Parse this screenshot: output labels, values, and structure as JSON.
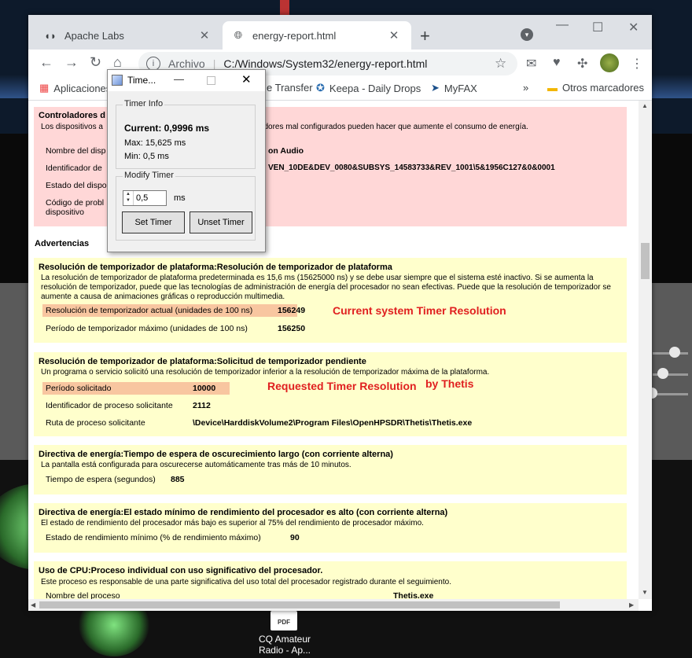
{
  "browser": {
    "tabs": [
      {
        "label": "Apache Labs",
        "active": false
      },
      {
        "label": "energy-report.html",
        "active": true
      }
    ],
    "address_scheme": "Archivo",
    "address_url": "C:/Windows/System32/energy-report.html"
  },
  "bookmarks": [
    {
      "label": "Aplicaciones",
      "icon": "apps-icon"
    },
    {
      "label": "e Transfer",
      "icon": "transfer-icon"
    },
    {
      "label": "Keepa - Daily Drops",
      "icon": "keepa-icon"
    },
    {
      "label": "MyFAX",
      "icon": "myfax-icon"
    },
    {
      "label": "»",
      "icon": "more-bookmarks-icon"
    },
    {
      "label": "Otros marcadores",
      "icon": "folder-icon"
    }
  ],
  "report": {
    "controllers": {
      "title": "Controladores d",
      "desc": "Los dispositivos a                                                  tienen controladores mal configurados pueden hacer que aumente el consumo de energía.",
      "rows": [
        {
          "label": "Nombre del disp",
          "value": "on Audio"
        },
        {
          "label": "Identificador de",
          "value": "VEN_10DE&DEV_0080&SUBSYS_14583733&REV_1001\\5&1956C127&0&0001"
        },
        {
          "label": "Estado del dispo",
          "value": ""
        },
        {
          "label": "Código de probl dispositivo",
          "value": ""
        }
      ]
    },
    "warnings_heading": "Advertencias",
    "sections": [
      {
        "title": "Resolución de temporizador de plataforma:Resolución de temporizador de plataforma",
        "desc": "La resolución de temporizador de plataforma predeterminada es 15,6 ms (15625000 ns) y se debe usar siempre que el sistema esté inactivo. Si se aumenta la resolución de temporizador, puede que las tecnologías de administración de energía del procesador no sean efectivas. Puede que la resolución de temporizador se aumente a causa de animaciones gráficas o reproducción multimedia.",
        "rows": [
          {
            "label": "Resolución de temporizador actual (unidades de 100 ns)",
            "value": "156249"
          },
          {
            "label": "Período de temporizador máximo (unidades de 100 ns)",
            "value": "156250"
          }
        ]
      },
      {
        "title": "Resolución de temporizador de plataforma:Solicitud de temporizador pendiente",
        "desc": "Un programa o servicio solicitó una resolución de temporizador inferior a la resolución de temporizador máxima de la plataforma.",
        "rows": [
          {
            "label": "Período solicitado",
            "value": "10000"
          },
          {
            "label": "Identificador de proceso solicitante",
            "value": "2112"
          },
          {
            "label": "Ruta de proceso solicitante",
            "value": "\\Device\\HarddiskVolume2\\Program Files\\OpenHPSDR\\Thetis\\Thetis.exe"
          }
        ]
      },
      {
        "title": "Directiva de energía:Tiempo de espera de oscurecimiento largo (con corriente alterna)",
        "desc": "La pantalla está configurada para oscurecerse automáticamente tras más de 10 minutos.",
        "rows": [
          {
            "label": "Tiempo de espera (segundos)",
            "value": "885"
          }
        ]
      },
      {
        "title": "Directiva de energía:El estado mínimo de rendimiento del procesador es alto (con corriente alterna)",
        "desc": "El estado de rendimiento del procesador más bajo es superior al 75% del rendimiento de procesador máximo.",
        "rows": [
          {
            "label": "Estado de rendimiento mínimo (% de rendimiento máximo)",
            "value": "90"
          }
        ]
      },
      {
        "title": "Uso de CPU:Proceso individual con uso significativo del procesador.",
        "desc": "Este proceso es responsable de una parte significativa del uso total del procesador registrado durante el seguimiento.",
        "rows": [
          {
            "label": "Nombre del proceso",
            "value": "Thetis.exe"
          }
        ]
      }
    ],
    "annotations": {
      "current": "Current system Timer Resolution",
      "requested": "Requested Timer Resolution",
      "by": "by Thetis"
    }
  },
  "timer_dialog": {
    "title": "Time...",
    "info_group": "Timer Info",
    "current": "Current:  0,9996 ms",
    "max": "Max: 15,625 ms",
    "min": "Min: 0,5 ms",
    "modify_group": "Modify Timer",
    "input_value": "0,5",
    "unit": "ms",
    "set_button": "Set Timer",
    "unset_button": "Unset Timer"
  },
  "desktop": {
    "pdf_label": "PDF",
    "icon_label": "CQ Amateur Radio - Ap..."
  }
}
